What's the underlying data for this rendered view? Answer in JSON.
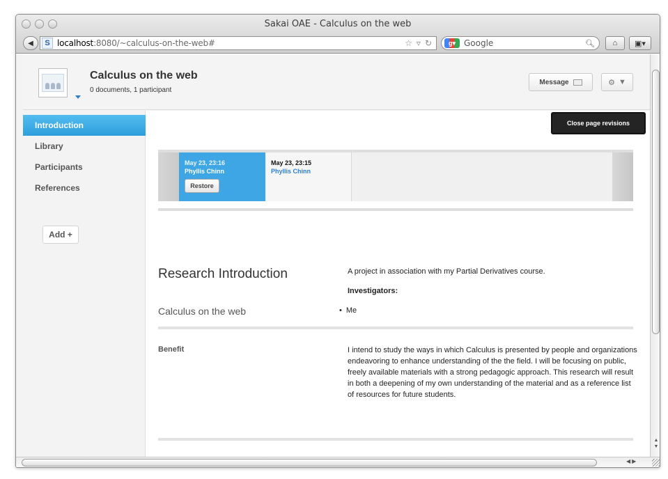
{
  "window": {
    "title": "Sakai OAE - Calculus on the web"
  },
  "toolbar": {
    "url_host": "localhost",
    "url_rest": ":8080/~calculus-on-the-web#",
    "site_badge": "S",
    "search_placeholder": "Google"
  },
  "header": {
    "title": "Calculus on the web",
    "subtitle": "0 documents, 1 participant",
    "message_label": "Message",
    "gear_caret": "▼"
  },
  "sidebar": {
    "items": [
      {
        "label": "Introduction",
        "active": true
      },
      {
        "label": "Library",
        "active": false
      },
      {
        "label": "Participants",
        "active": false
      },
      {
        "label": "References",
        "active": false
      }
    ],
    "add_label": "Add +"
  },
  "revisions": {
    "close_label": "Close page revisions",
    "items": [
      {
        "date": "May 23, 23:16",
        "author": "Phyllis Chinn",
        "selected": true
      },
      {
        "date": "May 23, 23:15",
        "author": "Phyllis Chinn",
        "selected": false
      }
    ],
    "restore_label": "Restore"
  },
  "content": {
    "research_title": "Research Introduction",
    "research_subtitle": "Calculus on the web",
    "intro_text": "A project in association with my Partial Derivatives course.",
    "investigators_label": "Investigators:",
    "investigators": [
      "Me"
    ],
    "benefit_label": "Benefit",
    "benefit_text": "I intend to study the ways in which Calculus is presented by people and organizations endeavoring to enhance understanding of the the field. I will be focusing on public, freely available materials with a strong pedagogic approach. This research will result in both a deepening of my own understanding of the material and as a reference list of resources for future students."
  }
}
